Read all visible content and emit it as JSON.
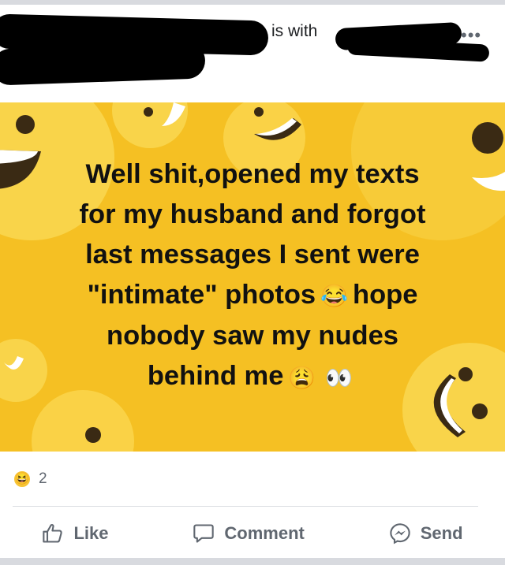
{
  "header": {
    "activity_text": "is with",
    "more_icon": "more-icon"
  },
  "post": {
    "lines": [
      "Well shit,opened my texts",
      "for my husband and forgot",
      "last messages I sent were",
      "\"intimate\" photos",
      "hope",
      "nobody saw my nudes",
      "behind me"
    ],
    "emoji_laugh": "😂",
    "emoji_weary": "😩",
    "emoji_eyes": "👀",
    "background_color": "#f5c023"
  },
  "reactions": {
    "icon": "haha-reaction-icon",
    "glyph": "😆",
    "count": "2"
  },
  "actions": {
    "like": "Like",
    "comment": "Comment",
    "send": "Send"
  }
}
